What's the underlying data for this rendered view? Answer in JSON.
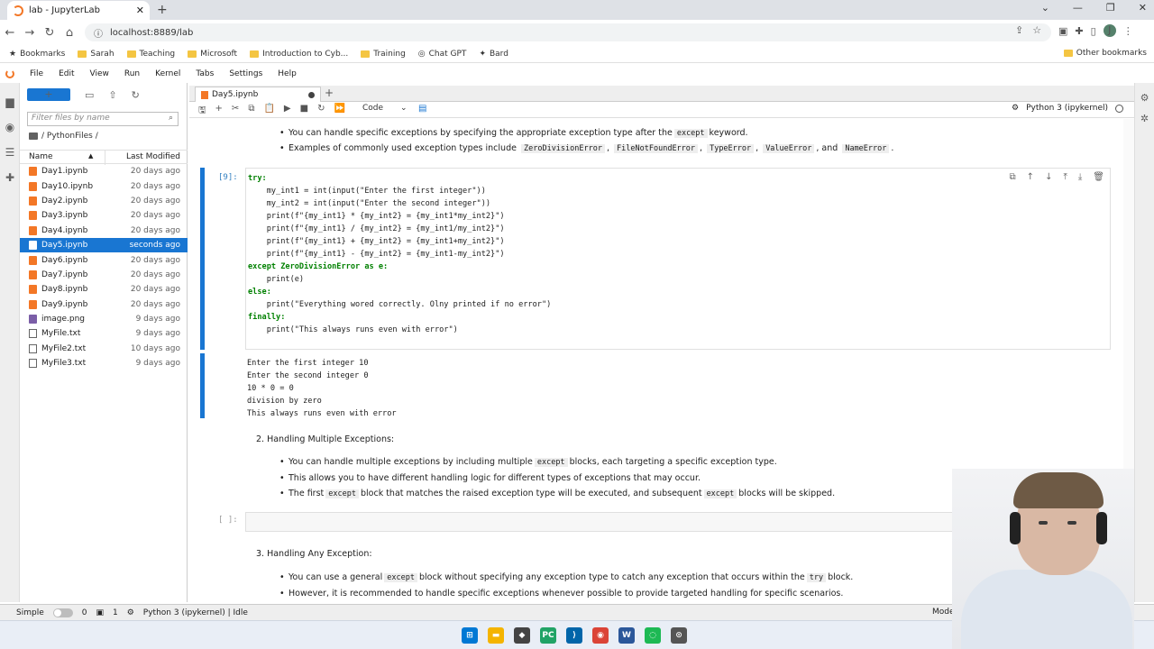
{
  "browser": {
    "tab_title": "lab - JupyterLab",
    "url": "localhost:8889/lab",
    "bookmarks": [
      "Bookmarks",
      "Sarah",
      "Teaching",
      "Microsoft",
      "Introduction to Cyb...",
      "Training",
      "Chat GPT",
      "Bard"
    ],
    "other_bookmarks": "Other bookmarks",
    "profile_initial": "J"
  },
  "menu": [
    "File",
    "Edit",
    "View",
    "Run",
    "Kernel",
    "Tabs",
    "Settings",
    "Help"
  ],
  "filebrowser": {
    "new_label": "+",
    "filter_placeholder": "Filter files by name",
    "breadcrumb": "/ PythonFiles /",
    "col_name": "Name",
    "col_modified": "Last Modified",
    "files": [
      {
        "name": "Day1.ipynb",
        "modified": "20 days ago",
        "type": "nb"
      },
      {
        "name": "Day10.ipynb",
        "modified": "20 days ago",
        "type": "nb"
      },
      {
        "name": "Day2.ipynb",
        "modified": "20 days ago",
        "type": "nb"
      },
      {
        "name": "Day3.ipynb",
        "modified": "20 days ago",
        "type": "nb"
      },
      {
        "name": "Day4.ipynb",
        "modified": "20 days ago",
        "type": "nb"
      },
      {
        "name": "Day5.ipynb",
        "modified": "seconds ago",
        "type": "nb",
        "selected": true
      },
      {
        "name": "Day6.ipynb",
        "modified": "20 days ago",
        "type": "nb"
      },
      {
        "name": "Day7.ipynb",
        "modified": "20 days ago",
        "type": "nb"
      },
      {
        "name": "Day8.ipynb",
        "modified": "20 days ago",
        "type": "nb"
      },
      {
        "name": "Day9.ipynb",
        "modified": "20 days ago",
        "type": "nb"
      },
      {
        "name": "image.png",
        "modified": "9 days ago",
        "type": "img"
      },
      {
        "name": "MyFile.txt",
        "modified": "9 days ago",
        "type": "txt"
      },
      {
        "name": "MyFile2.txt",
        "modified": "10 days ago",
        "type": "txt"
      },
      {
        "name": "MyFile3.txt",
        "modified": "9 days ago",
        "type": "txt"
      }
    ]
  },
  "notebook": {
    "tab_title": "Day5.ipynb",
    "cell_type": "Code",
    "kernel": "Python 3 (ipykernel)",
    "md1": {
      "b1_pre": "You can handle specific exceptions by specifying the appropriate exception type after the",
      "b1_code": "except",
      "b1_post": "keyword.",
      "b2_pre": "Examples of commonly used exception types include",
      "b2_codes": [
        "ZeroDivisionError",
        "FileNotFoundError",
        "TypeError",
        "ValueError",
        "NameError"
      ],
      "b2_and": "and",
      "b2_post": "."
    },
    "code_prompt": "[9]:",
    "code_lines": [
      "try:",
      "    my_int1 = int(input(\"Enter the first integer\"))",
      "    my_int2 = int(input(\"Enter the second integer\"))",
      "    print(f\"{my_int1} * {my_int2} = {my_int1*my_int2}\")",
      "    print(f\"{my_int1} / {my_int2} = {my_int1/my_int2}\")",
      "    print(f\"{my_int1} + {my_int2} = {my_int1+my_int2}\")",
      "    print(f\"{my_int1} - {my_int2} = {my_int1-my_int2}\")",
      "",
      "except ZeroDivisionError as e:",
      "    print(e)",
      "else:",
      "    print(\"Everything wored correctly. Olny printed if no error\")",
      "finally:",
      "    print(\"This always runs even with error\")"
    ],
    "output_lines": [
      "Enter the first integer 10",
      "Enter the second integer 0",
      "10 * 0 = 0",
      "division by zero",
      "This always runs even with error"
    ],
    "md2": {
      "heading": "2. Handling Multiple Exceptions:",
      "b1_pre": "You can handle multiple exceptions by including multiple",
      "b1_code": "except",
      "b1_post": "blocks, each targeting a specific exception type.",
      "b2": "This allows you to have different handling logic for different types of exceptions that may occur.",
      "b3_pre": "The first",
      "b3_code1": "except",
      "b3_mid": "block that matches the raised exception type will be executed, and subsequent",
      "b3_code2": "except",
      "b3_post": "blocks will be skipped."
    },
    "empty_prompt": "[ ]:",
    "md3": {
      "heading": "3. Handling Any Exception:",
      "b1_pre": "You can use a general",
      "b1_code": "except",
      "b1_mid": "block without specifying any exception type to catch any exception that occurs within the",
      "b1_code2": "try",
      "b1_post": "block.",
      "b2": "However, it is recommended to handle specific exceptions whenever possible to provide targeted handling for specific scenarios."
    }
  },
  "status": {
    "mode": "Simple",
    "count1": "0",
    "count2": "1",
    "kernel_status": "Python 3 (ipykernel) | Idle",
    "right": "Mode"
  }
}
